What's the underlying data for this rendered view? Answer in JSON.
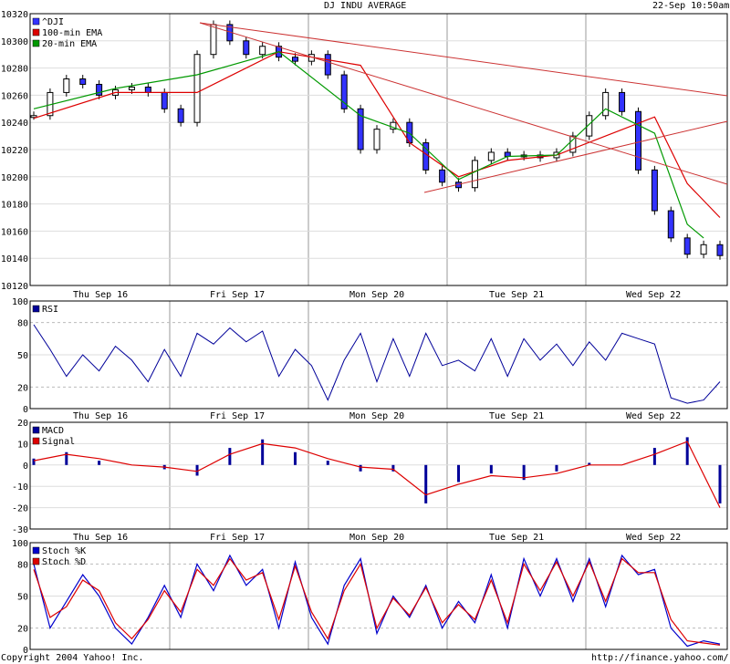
{
  "header": {
    "title": "DJ INDU AVERAGE",
    "timestamp": "22-Sep 10:50am"
  },
  "footer": {
    "copyright": "Copyright 2004 Yahoo! Inc.",
    "url": "http://finance.yahoo.com/"
  },
  "colors": {
    "price_series": "#3333ff",
    "ema100": "#dd0000",
    "ema20": "#009900",
    "trendline": "#cc3333",
    "rsi": "#000099",
    "macd": "#000099",
    "signal": "#dd0000",
    "stoch_k": "#0000cc",
    "stoch_d": "#dd0000",
    "grid": "#999999"
  },
  "chart_data": [
    {
      "type": "candlestick",
      "panel": "price",
      "legend": [
        "^DJI",
        "100-min EMA",
        "20-min EMA"
      ],
      "x_ticks": [
        "Thu Sep 16",
        "Fri Sep 17",
        "Mon Sep 20",
        "Tue Sep 21",
        "Wed Sep 22"
      ],
      "y_ticks": [
        "10320",
        "10300",
        "10280",
        "10260",
        "10240",
        "10220",
        "10200",
        "10180",
        "10160",
        "10140",
        "10120"
      ],
      "ylim": [
        10120,
        10320
      ],
      "series": [
        {
          "name": "^DJI",
          "x": [
            0,
            0.1,
            0.2,
            0.3,
            0.4,
            0.5,
            0.6,
            0.7,
            0.8,
            0.9,
            1.0,
            1.1,
            1.2,
            1.3,
            1.4,
            1.5,
            1.6,
            1.7,
            1.8,
            1.9,
            2.0,
            2.1,
            2.2,
            2.3,
            2.4,
            2.5,
            2.6,
            2.7,
            2.8,
            2.9,
            3.0,
            3.1,
            3.2,
            3.3,
            3.4,
            3.5,
            3.6,
            3.7,
            3.8,
            3.9,
            4.0,
            4.1,
            4.2
          ],
          "values": [
            10245,
            10262,
            10272,
            10268,
            10260,
            10264,
            10266,
            10262,
            10250,
            10240,
            10290,
            10312,
            10300,
            10290,
            10296,
            10288,
            10285,
            10290,
            10275,
            10250,
            10220,
            10235,
            10240,
            10225,
            10205,
            10196,
            10192,
            10212,
            10218,
            10215,
            10216,
            10214,
            10218,
            10230,
            10245,
            10262,
            10248,
            10205,
            10175,
            10155,
            10143,
            10150,
            10142
          ]
        },
        {
          "name": "100-min EMA",
          "x": [
            0,
            0.5,
            1.0,
            1.5,
            2.0,
            2.3,
            2.6,
            2.9,
            3.2,
            3.5,
            3.8,
            4.0,
            4.2
          ],
          "values": [
            10243,
            10262,
            10262,
            10292,
            10282,
            10225,
            10200,
            10212,
            10216,
            10230,
            10244,
            10195,
            10170
          ]
        },
        {
          "name": "20-min EMA",
          "x": [
            0,
            0.5,
            1.0,
            1.5,
            2.0,
            2.3,
            2.6,
            2.9,
            3.2,
            3.5,
            3.8,
            4.0,
            4.1
          ],
          "values": [
            10250,
            10265,
            10275,
            10292,
            10245,
            10232,
            10198,
            10215,
            10216,
            10250,
            10232,
            10165,
            10155
          ]
        }
      ]
    },
    {
      "type": "line",
      "panel": "rsi",
      "legend": [
        "RSI"
      ],
      "y_ticks": [
        "100",
        "80",
        "50",
        "20",
        "0"
      ],
      "ylim": [
        0,
        100
      ],
      "series": [
        {
          "name": "RSI",
          "x": [
            0,
            0.1,
            0.2,
            0.3,
            0.4,
            0.5,
            0.6,
            0.7,
            0.8,
            0.9,
            1.0,
            1.1,
            1.2,
            1.3,
            1.4,
            1.5,
            1.6,
            1.7,
            1.8,
            1.9,
            2.0,
            2.1,
            2.2,
            2.3,
            2.4,
            2.5,
            2.6,
            2.7,
            2.8,
            2.9,
            3.0,
            3.1,
            3.2,
            3.3,
            3.4,
            3.5,
            3.6,
            3.7,
            3.8,
            3.9,
            4.0,
            4.1,
            4.2
          ],
          "values": [
            78,
            55,
            30,
            50,
            35,
            58,
            45,
            25,
            55,
            30,
            70,
            60,
            75,
            62,
            72,
            30,
            55,
            40,
            8,
            45,
            70,
            25,
            65,
            30,
            70,
            40,
            45,
            35,
            65,
            30,
            65,
            45,
            60,
            40,
            62,
            45,
            70,
            65,
            60,
            10,
            5,
            8,
            25
          ]
        }
      ]
    },
    {
      "type": "bar",
      "panel": "macd",
      "legend": [
        "MACD",
        "Signal"
      ],
      "y_ticks": [
        "20",
        "10",
        "0",
        "-10",
        "-20",
        "-30"
      ],
      "ylim": [
        -30,
        20
      ],
      "series": [
        {
          "name": "MACD",
          "x": [
            0,
            0.2,
            0.4,
            0.6,
            0.8,
            1.0,
            1.2,
            1.4,
            1.6,
            1.8,
            2.0,
            2.2,
            2.4,
            2.6,
            2.8,
            3.0,
            3.2,
            3.4,
            3.6,
            3.8,
            4.0,
            4.2
          ],
          "values": [
            3,
            6,
            2,
            0,
            -2,
            -5,
            8,
            12,
            6,
            2,
            -3,
            -3,
            -18,
            -8,
            -4,
            -7,
            -3,
            1,
            0,
            8,
            13,
            -18
          ]
        },
        {
          "name": "Signal",
          "x": [
            0,
            0.2,
            0.4,
            0.6,
            0.8,
            1.0,
            1.2,
            1.4,
            1.6,
            1.8,
            2.0,
            2.2,
            2.4,
            2.6,
            2.8,
            3.0,
            3.2,
            3.4,
            3.6,
            3.8,
            4.0,
            4.2
          ],
          "values": [
            2,
            5,
            3,
            0,
            -1,
            -3,
            5,
            10,
            8,
            3,
            -1,
            -2,
            -14,
            -9,
            -5,
            -6,
            -4,
            0,
            0,
            5,
            11,
            -20
          ]
        }
      ]
    },
    {
      "type": "line",
      "panel": "stochastic",
      "legend": [
        "Stoch %K",
        "Stoch %D"
      ],
      "y_ticks": [
        "100",
        "80",
        "50",
        "20",
        "0"
      ],
      "ylim": [
        0,
        100
      ],
      "series": [
        {
          "name": "Stoch %K",
          "x": [
            0,
            0.1,
            0.2,
            0.3,
            0.4,
            0.5,
            0.6,
            0.7,
            0.8,
            0.9,
            1.0,
            1.1,
            1.2,
            1.3,
            1.4,
            1.5,
            1.6,
            1.7,
            1.8,
            1.9,
            2.0,
            2.1,
            2.2,
            2.3,
            2.4,
            2.5,
            2.6,
            2.7,
            2.8,
            2.9,
            3.0,
            3.1,
            3.2,
            3.3,
            3.4,
            3.5,
            3.6,
            3.7,
            3.8,
            3.9,
            4.0,
            4.1,
            4.2
          ],
          "values": [
            80,
            20,
            45,
            70,
            50,
            20,
            5,
            30,
            60,
            30,
            80,
            55,
            88,
            60,
            75,
            20,
            82,
            30,
            5,
            60,
            85,
            15,
            50,
            30,
            60,
            20,
            45,
            25,
            70,
            20,
            85,
            50,
            85,
            45,
            85,
            40,
            88,
            70,
            75,
            20,
            3,
            8,
            5
          ]
        },
        {
          "name": "Stoch %D",
          "x": [
            0,
            0.1,
            0.2,
            0.3,
            0.4,
            0.5,
            0.6,
            0.7,
            0.8,
            0.9,
            1.0,
            1.1,
            1.2,
            1.3,
            1.4,
            1.5,
            1.6,
            1.7,
            1.8,
            1.9,
            2.0,
            2.1,
            2.2,
            2.3,
            2.4,
            2.5,
            2.6,
            2.7,
            2.8,
            2.9,
            3.0,
            3.1,
            3.2,
            3.3,
            3.4,
            3.5,
            3.6,
            3.7,
            3.8,
            3.9,
            4.0,
            4.1,
            4.2
          ],
          "values": [
            75,
            30,
            40,
            65,
            55,
            25,
            10,
            28,
            55,
            35,
            75,
            60,
            85,
            65,
            72,
            28,
            78,
            35,
            10,
            55,
            80,
            20,
            48,
            32,
            58,
            25,
            42,
            28,
            65,
            25,
            80,
            55,
            82,
            50,
            82,
            45,
            85,
            72,
            72,
            28,
            8,
            6,
            4
          ]
        }
      ]
    }
  ]
}
